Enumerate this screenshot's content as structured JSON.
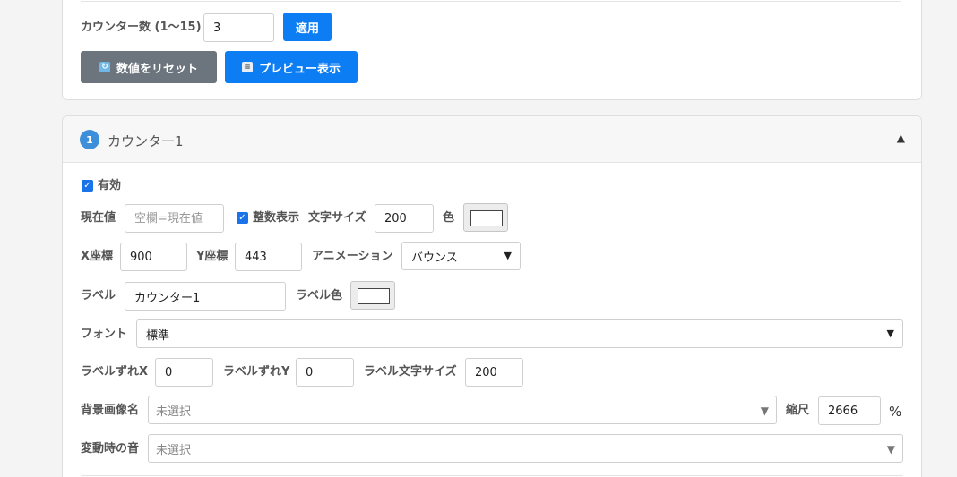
{
  "settings": {
    "counter_count_label": "カウンター数 (1〜15)",
    "counter_count_value": "3",
    "apply_label": "適用",
    "reset_label": "数値をリセット",
    "preview_label": "プレビュー表示"
  },
  "counter": {
    "index": "1",
    "title": "カウンター1",
    "enabled_label": "有効",
    "current_value_label": "現在値",
    "current_value_placeholder": "空欄=現在値",
    "integer_display_label": "整数表示",
    "font_size_label": "文字サイズ",
    "font_size_value": "200",
    "color_label": "色",
    "x_label": "X座標",
    "x_value": "900",
    "y_label": "Y座標",
    "y_value": "443",
    "animation_label": "アニメーション",
    "animation_value": "バウンス",
    "label_label": "ラベル",
    "label_value": "カウンター1",
    "label_color_label": "ラベル色",
    "font_label": "フォント",
    "font_value": "標準",
    "label_offset_x_label": "ラベルずれX",
    "label_offset_x_value": "0",
    "label_offset_y_label": "ラベルずれY",
    "label_offset_y_value": "0",
    "label_font_size_label": "ラベル文字サイズ",
    "label_font_size_value": "200",
    "bg_image_label": "背景画像名",
    "bg_image_value": "未選択",
    "scale_label": "縮尺",
    "scale_value": "2666",
    "scale_unit": "%",
    "sound_label": "変動時の音",
    "sound_value": "未選択"
  },
  "colors": {
    "primary": "#0d7df3",
    "secondary": "#6c757d",
    "badge": "#3d8fd9",
    "color_swatch": "#ffffff",
    "label_color_swatch": "#ffffff"
  },
  "icons": {
    "reset": "refresh-icon",
    "preview": "document-icon",
    "collapse": "triangle-up-icon",
    "checkbox": "check-icon",
    "select": "chevron-down-icon"
  }
}
